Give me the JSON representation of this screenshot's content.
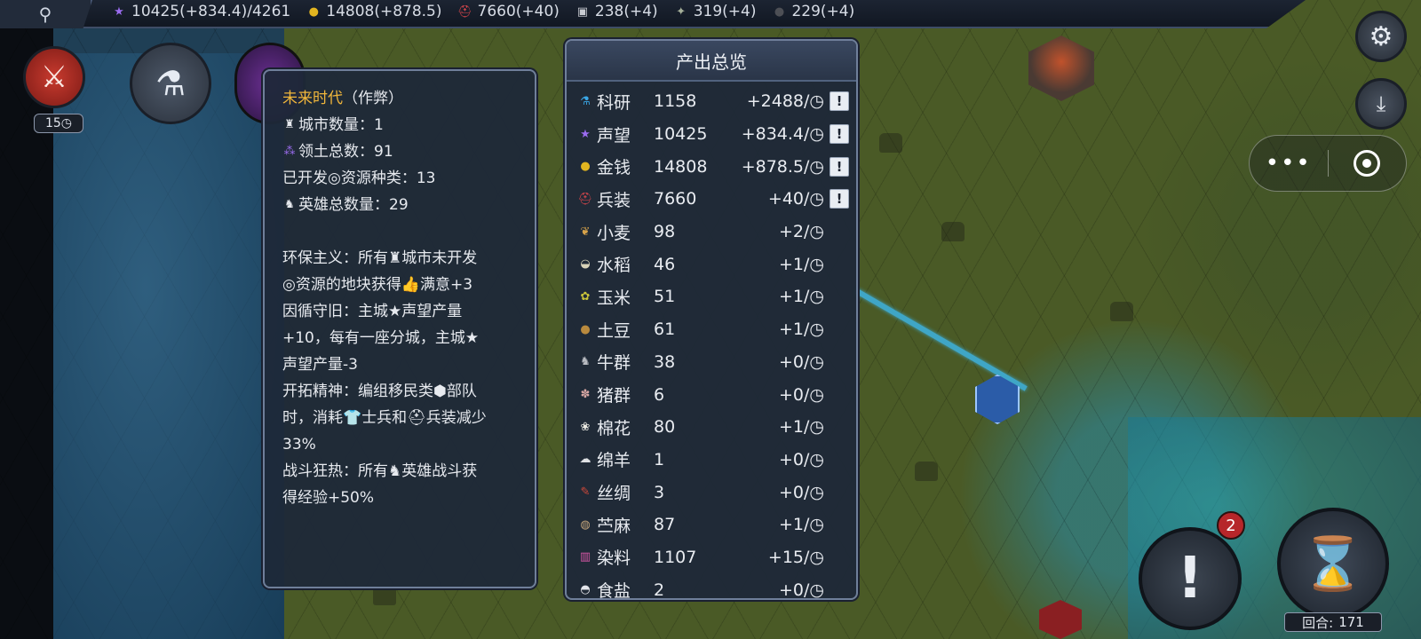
{
  "colors": {
    "era_title": "#f0b63b",
    "panel_bg": "#1e2838",
    "panel_border": "#6f7f9a",
    "prestige": "#9b6cf0",
    "gold": "#e2b520",
    "equipment": "#e0474c",
    "alert_badge": "#b6262a"
  },
  "topbar": {
    "search_icon": "magnifier-icon",
    "resources": [
      {
        "icon": "prestige-star-icon",
        "glyph": "★",
        "color": "#9b6cf0",
        "text": "10425(+834.4)/4261"
      },
      {
        "icon": "gold-coin-icon",
        "glyph": "●",
        "color": "#e2b520",
        "text": "14808(+878.5)"
      },
      {
        "icon": "equipment-icon",
        "glyph": "⛑",
        "color": "#e0474c",
        "text": "7660(+40)"
      },
      {
        "icon": "vehicle-icon",
        "glyph": "▣",
        "color": "#c9ccd2",
        "text": "238(+4)"
      },
      {
        "icon": "weapon-icon",
        "glyph": "✦",
        "color": "#a6b09a",
        "text": "319(+4)"
      },
      {
        "icon": "fuel-icon",
        "glyph": "●",
        "color": "#4d4f55",
        "text": "229(+4)"
      }
    ]
  },
  "left_buttons": {
    "turns_badge": "15"
  },
  "era_panel": {
    "era_name": "未来时代",
    "era_suffix": "（作弊）",
    "city_count": "城市数量：1",
    "territory_count": "领土总数：91",
    "resource_types": "已开发◎资源种类：13",
    "hero_count": "英雄总数量：29",
    "policies": [
      "环保主义：所有♜城市未开发",
      "◎资源的地块获得👍满意+3",
      "因循守旧：主城★声望产量",
      "+10，每有一座分城，主城★",
      "声望产量-3",
      "开拓精神：编组移民类⬢部队",
      "时，消耗👕士兵和⛑兵装减少",
      "33%",
      "战斗狂热：所有♞英雄战斗获",
      "得经验+50%"
    ]
  },
  "production_panel": {
    "title": "产出总览",
    "rows": [
      {
        "icon": "science-flask-icon",
        "glyph": "⚗",
        "color": "#3aa8e8",
        "name": "科研",
        "value": "1158",
        "rate": "+2488/◷",
        "has_detail": true
      },
      {
        "icon": "prestige-star-icon",
        "glyph": "★",
        "color": "#9b6cf0",
        "name": "声望",
        "value": "10425",
        "rate": "+834.4/◷",
        "has_detail": true
      },
      {
        "icon": "gold-coin-icon",
        "glyph": "●",
        "color": "#e2b520",
        "name": "金钱",
        "value": "14808",
        "rate": "+878.5/◷",
        "has_detail": true
      },
      {
        "icon": "equipment-icon",
        "glyph": "⛑",
        "color": "#e0474c",
        "name": "兵装",
        "value": "7660",
        "rate": "+40/◷",
        "has_detail": true
      },
      {
        "icon": "wheat-icon",
        "glyph": "❦",
        "color": "#d6a24a",
        "name": "小麦",
        "value": "98",
        "rate": "+2/◷",
        "has_detail": false
      },
      {
        "icon": "rice-icon",
        "glyph": "◒",
        "color": "#d9d3b8",
        "name": "水稻",
        "value": "46",
        "rate": "+1/◷",
        "has_detail": false
      },
      {
        "icon": "corn-icon",
        "glyph": "✿",
        "color": "#c9c33a",
        "name": "玉米",
        "value": "51",
        "rate": "+1/◷",
        "has_detail": false
      },
      {
        "icon": "potato-icon",
        "glyph": "●",
        "color": "#b98a3e",
        "name": "土豆",
        "value": "61",
        "rate": "+1/◷",
        "has_detail": false
      },
      {
        "icon": "cattle-icon",
        "glyph": "♞",
        "color": "#b9bcc2",
        "name": "牛群",
        "value": "38",
        "rate": "+0/◷",
        "has_detail": false
      },
      {
        "icon": "pig-icon",
        "glyph": "✽",
        "color": "#d7a7a4",
        "name": "猪群",
        "value": "6",
        "rate": "+0/◷",
        "has_detail": false
      },
      {
        "icon": "cotton-icon",
        "glyph": "❀",
        "color": "#eceae3",
        "name": "棉花",
        "value": "80",
        "rate": "+1/◷",
        "has_detail": false
      },
      {
        "icon": "sheep-icon",
        "glyph": "☁",
        "color": "#dfe1e4",
        "name": "绵羊",
        "value": "1",
        "rate": "+0/◷",
        "has_detail": false
      },
      {
        "icon": "silk-icon",
        "glyph": "✎",
        "color": "#d0493a",
        "name": "丝绸",
        "value": "3",
        "rate": "+0/◷",
        "has_detail": false
      },
      {
        "icon": "ramie-icon",
        "glyph": "◍",
        "color": "#c2a47a",
        "name": "苎麻",
        "value": "87",
        "rate": "+1/◷",
        "has_detail": false
      },
      {
        "icon": "dye-icon",
        "glyph": "▥",
        "color": "#d657a6",
        "name": "染料",
        "value": "1107",
        "rate": "+15/◷",
        "has_detail": false
      },
      {
        "icon": "salt-icon",
        "glyph": "◓",
        "color": "#e3e5ea",
        "name": "食盐",
        "value": "2",
        "rate": "+0/◷",
        "has_detail": false
      }
    ]
  },
  "right_controls": {
    "settings_icon": "gear-icon",
    "save_icon": "download-tray-icon",
    "capsule_more": "•••",
    "alert_count": "2",
    "turn_label": "回合:",
    "turn_number": "171"
  }
}
